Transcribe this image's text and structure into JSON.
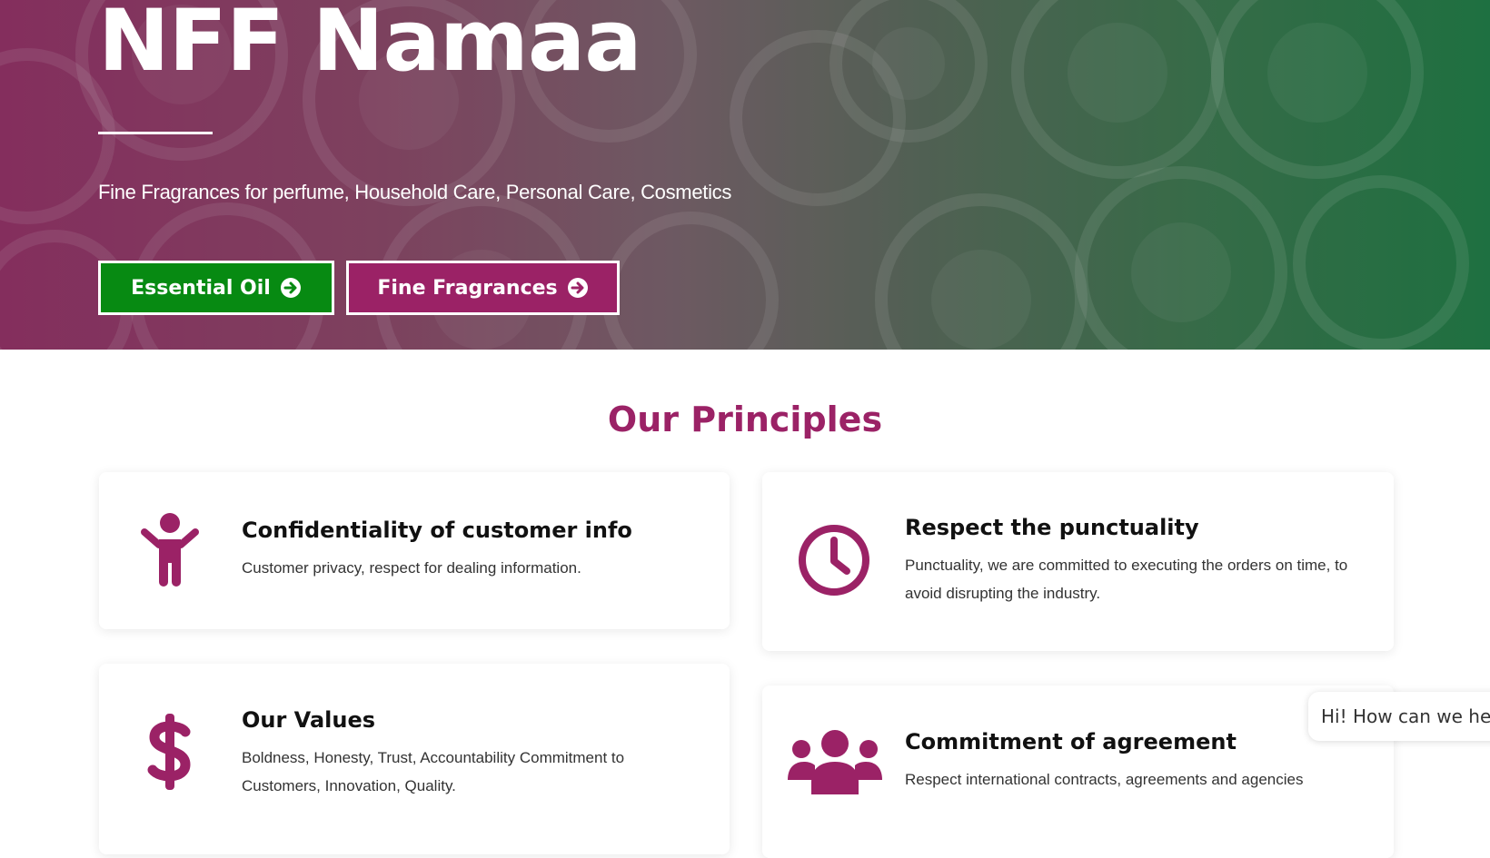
{
  "hero": {
    "title": "NFF Namaa",
    "subtitle": "Fine Fragrances for perfume, Household Care, Personal Care, Cosmetics",
    "buttons": [
      {
        "label": "Essential Oil",
        "icon": "arrow-circle-right-icon",
        "color": "#078a12"
      },
      {
        "label": "Fine Fragrances",
        "icon": "arrow-circle-right-icon",
        "color": "#9b2266"
      }
    ],
    "gradient": {
      "start": "#97356a",
      "end": "#23804a"
    }
  },
  "principles": {
    "heading": "Our Principles",
    "accent": "#9b2266",
    "cards": [
      {
        "icon": "child-figure-icon",
        "title": "Confidentiality of customer info",
        "text": "Customer privacy, respect for dealing information."
      },
      {
        "icon": "clock-icon",
        "title": "Respect the punctuality",
        "text": "Punctuality, we are committed to executing the orders on time, to avoid disrupting the industry."
      },
      {
        "icon": "dollar-sign-icon",
        "title": "Our Values",
        "text": "Boldness, Honesty, Trust, Accountability Commitment to Customers, Innovation, Quality."
      },
      {
        "icon": "people-group-icon",
        "title": "Commitment of agreement",
        "text": "Respect international contracts, agreements and agencies"
      }
    ]
  },
  "chat": {
    "message": "Hi! How can we help?"
  }
}
